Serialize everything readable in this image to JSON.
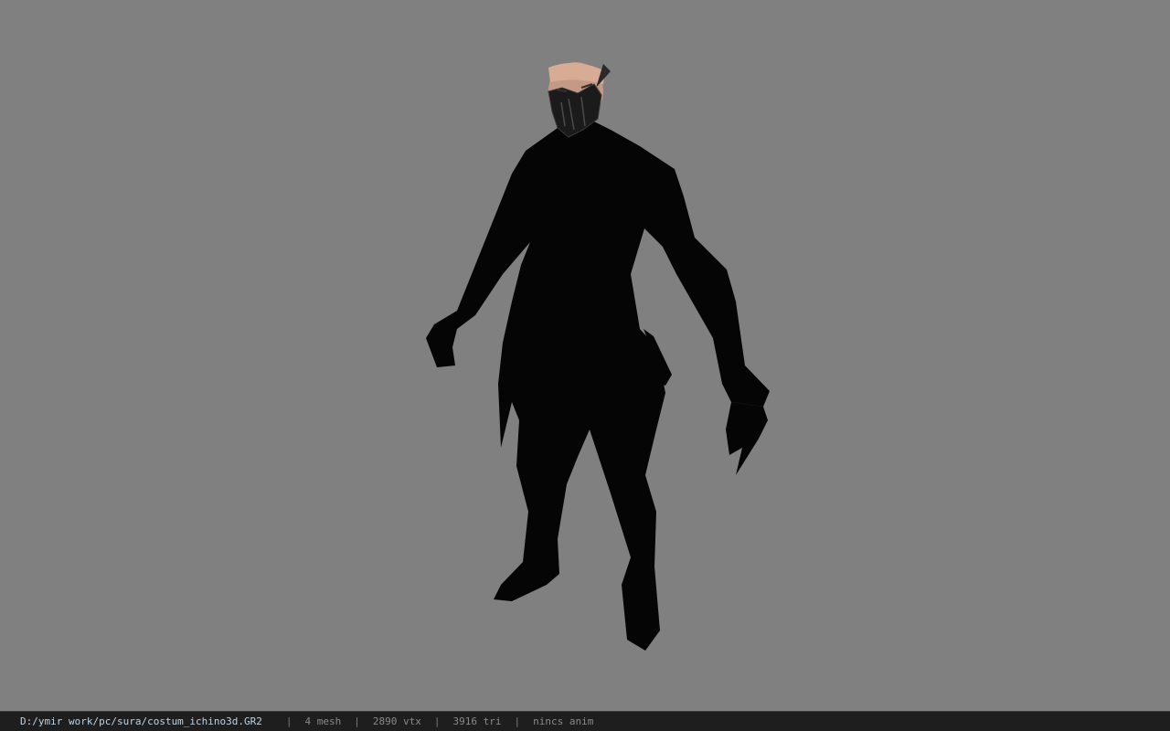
{
  "viewer": {
    "background_color": "#808080",
    "model_name": "costum_ichino3d.GR2"
  },
  "status_bar": {
    "file_path": "D:/ymir work/pc/sura/costum_ichino3d.GR2",
    "separator": "|",
    "mesh_count": "4 mesh",
    "vertex_count": "2890 vtx",
    "triangle_count": "3916 tri",
    "animation": "nincs anim"
  }
}
